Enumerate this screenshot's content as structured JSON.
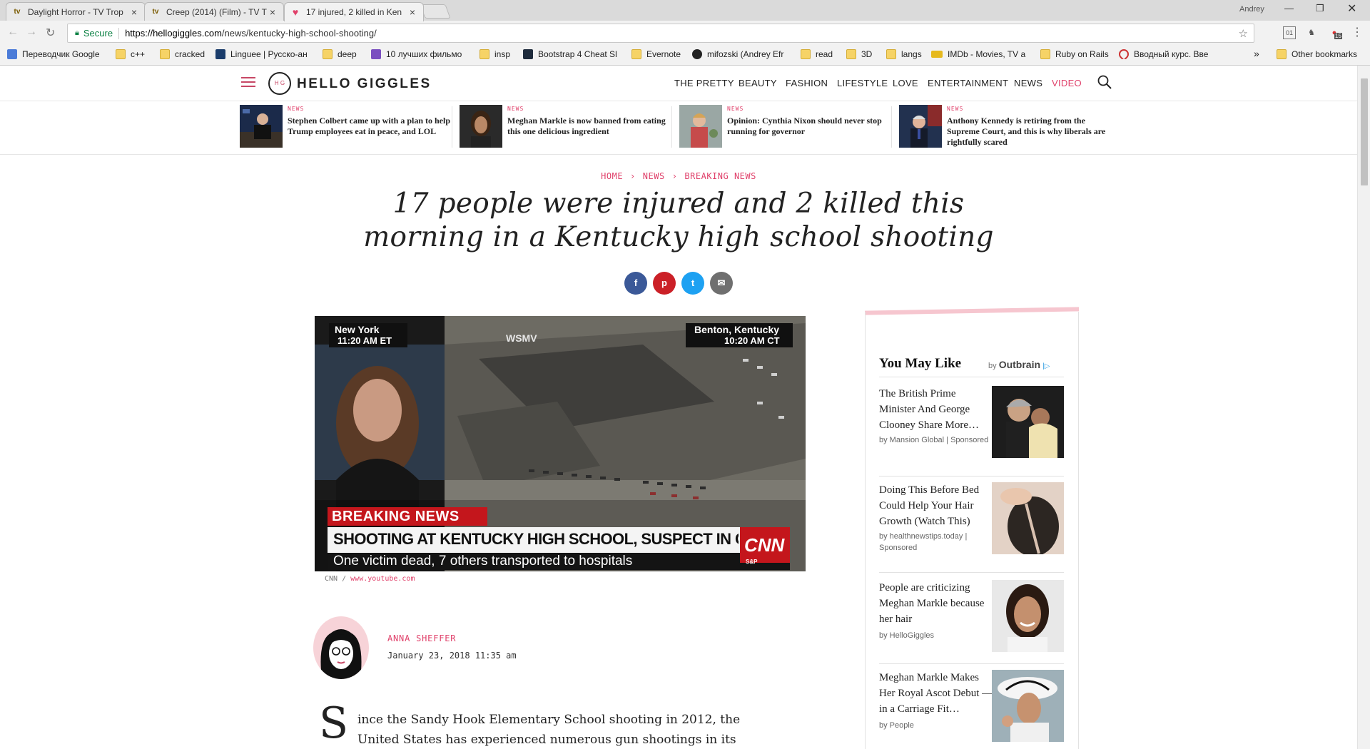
{
  "browser": {
    "tabs": [
      {
        "title": "Daylight Horror - TV Trop",
        "favicon": "tv"
      },
      {
        "title": "Creep (2014) (Film) - TV T",
        "favicon": "tv"
      },
      {
        "title": "17 injured, 2 killed in Ken",
        "favicon": "heart"
      }
    ],
    "user": "Andrey",
    "secure_label": "Secure",
    "url_domain": "https://hellogiggles.com",
    "url_path": "/news/kentucky-high-school-shooting/",
    "extension_badge": "15",
    "bookmarks": [
      "Переводчик Google",
      "c++",
      "cracked",
      "Linguee | Русско-ан",
      "deep",
      "10 лучших фильмо",
      "insp",
      "Bootstrap 4 Cheat Sl",
      "Evernote",
      "mifozski (Andrey Efr",
      "read",
      "3D",
      "langs",
      "IMDb - Movies, TV a",
      "Ruby on Rails",
      "Вводный курс. Вве"
    ],
    "bookmarks_overflow": "»",
    "other_bookmarks": "Other bookmarks"
  },
  "site": {
    "logo_mark": "H G",
    "logo_text": "HELLO GIGGLES",
    "nav": [
      "THE PRETTY",
      "BEAUTY",
      "FASHION",
      "LIFESTYLE",
      "LOVE",
      "ENTERTAINMENT",
      "NEWS",
      "VIDEO"
    ],
    "accent_color": "#e0406a"
  },
  "stories": [
    {
      "category": "NEWS",
      "headline": "Stephen Colbert came up with a plan to help Trump employees eat in peace, and LOL"
    },
    {
      "category": "NEWS",
      "headline": "Meghan Markle is now banned from eating this one delicious ingredient"
    },
    {
      "category": "NEWS",
      "headline": "Opinion: Cynthia Nixon should never stop running for governor"
    },
    {
      "category": "NEWS",
      "headline": "Anthony Kennedy is retiring from the Supreme Court, and this is why liberals are rightfully scared"
    }
  ],
  "article": {
    "breadcrumbs": [
      "HOME",
      "NEWS",
      "BREAKING NEWS"
    ],
    "breadcrumb_sep": "›",
    "title_line1": "17 people were injured and 2 killed this",
    "title_line2": "morning in a Kentucky high school shooting",
    "share": [
      "f",
      "p",
      "t",
      "✉"
    ],
    "video": {
      "left_location": "New York",
      "left_time": "11:20 AM ET",
      "channel": "WSMV",
      "right_location": "Benton, Kentucky",
      "right_time": "10:20 AM CT",
      "banner": "BREAKING NEWS",
      "headline": "SHOOTING AT KENTUCKY HIGH SCHOOL, SUSPECT IN CUSTODY",
      "subline": "One victim dead, 7 others transported to hospitals",
      "logo": "CNN",
      "ticker_left": "S&P"
    },
    "caption_source": "CNN",
    "caption_sep": "/",
    "caption_link": "www.youtube.com",
    "author": "ANNA SHEFFER",
    "date": "January 23, 2018 11:35 am",
    "dropcap": "S",
    "body_line1": "ince the Sandy Hook Elementary School shooting in 2012, the",
    "body_line2": "United States has experienced numerous gun shootings in its"
  },
  "sidebar": {
    "title": "You May Like",
    "by": "by",
    "brand": "Outbrain",
    "items": [
      {
        "title": "The British Prime Minister And George Clooney Share More…",
        "source": "by Mansion Global | Sponsored"
      },
      {
        "title": "Doing This Before Bed Could Help Your Hair Growth (Watch This)",
        "source": "by healthnewstips.today | Sponsored"
      },
      {
        "title": "People are criticizing Meghan Markle because her hair",
        "source": "by HelloGiggles"
      },
      {
        "title": "Meghan Markle Makes Her Royal Ascot Debut — in a Carriage Fit…",
        "source": "by People"
      }
    ]
  }
}
